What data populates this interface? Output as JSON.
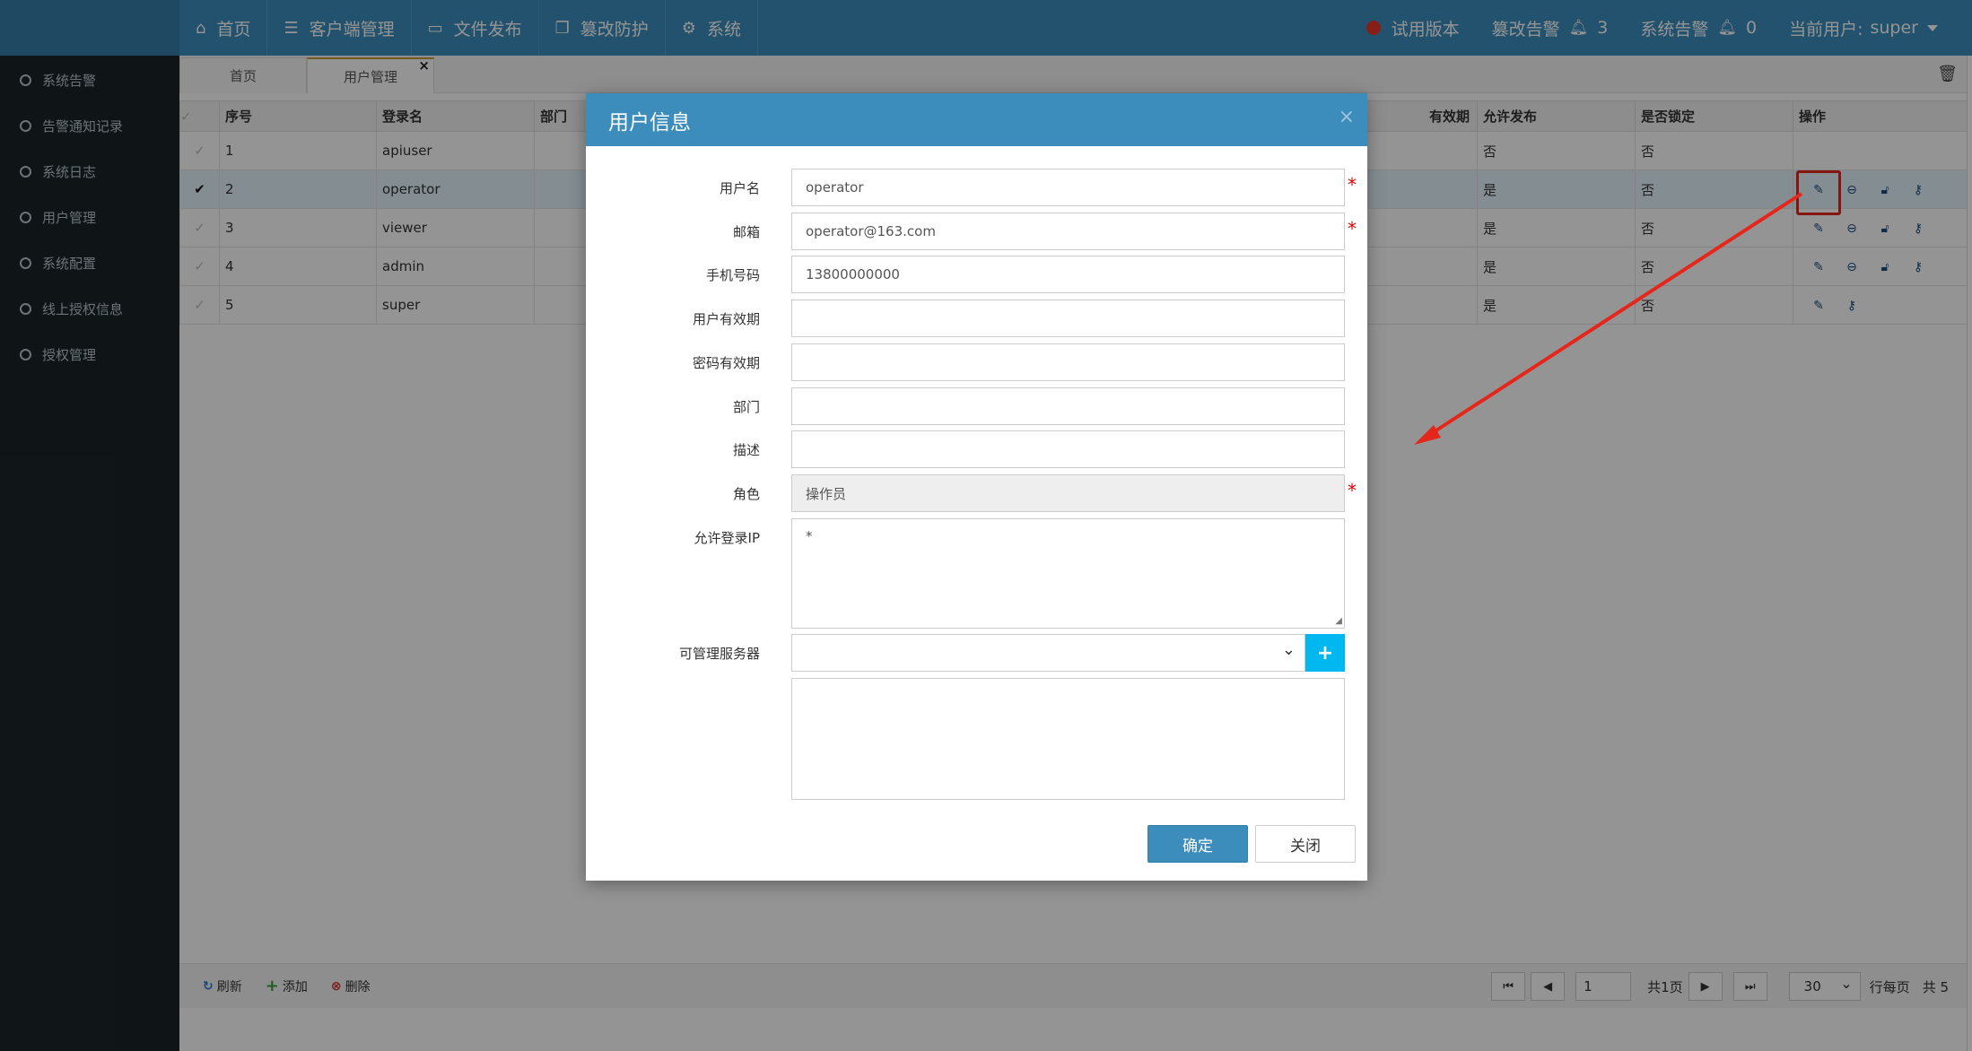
{
  "topnav": {
    "items": [
      {
        "icon": "home-icon",
        "glyph": "⌂",
        "label": "首页"
      },
      {
        "icon": "server-icon",
        "glyph": "☰",
        "label": "客户端管理"
      },
      {
        "icon": "laptop-icon",
        "glyph": "▭",
        "label": "文件发布"
      },
      {
        "icon": "copy-icon",
        "glyph": "❐",
        "label": "篡改防护"
      },
      {
        "icon": "cogs-icon",
        "glyph": "⚙",
        "label": "系统"
      }
    ],
    "trial_label": "试用版本",
    "tamper_alert_label": "篡改告警",
    "tamper_alert_count": "3",
    "system_alert_label": "系统告警",
    "system_alert_count": "0",
    "current_user_label": "当前用户:",
    "current_user": "super"
  },
  "sidebar": {
    "items": [
      {
        "label": "系统告警"
      },
      {
        "label": "告警通知记录"
      },
      {
        "label": "系统日志"
      },
      {
        "label": "用户管理"
      },
      {
        "label": "系统配置"
      },
      {
        "label": "线上授权信息"
      },
      {
        "label": "授权管理"
      }
    ]
  },
  "tabs": {
    "home": "首页",
    "user_mgmt": "用户管理",
    "close_glyph": "×"
  },
  "grid": {
    "headers": {
      "index": "序号",
      "login": "登录名",
      "dept": "部门",
      "expire": "有效期",
      "allow_publish": "允许发布",
      "locked": "是否锁定",
      "ops": "操作"
    },
    "rows": [
      {
        "index": "1",
        "login": "apiuser",
        "allow_publish": "否",
        "locked": "否"
      },
      {
        "index": "2",
        "login": "operator",
        "allow_publish": "是",
        "locked": "否"
      },
      {
        "index": "3",
        "login": "viewer",
        "allow_publish": "是",
        "locked": "否"
      },
      {
        "index": "4",
        "login": "admin",
        "allow_publish": "是",
        "locked": "否"
      },
      {
        "index": "5",
        "login": "super",
        "allow_publish": "是",
        "locked": "否"
      }
    ]
  },
  "footer": {
    "refresh": "刷新",
    "add": "添加",
    "delete": "删除",
    "page_value": "1",
    "total_pages": "共1页",
    "page_size": "30",
    "rows_per_page": "行每页",
    "total": "共 5"
  },
  "modal": {
    "title": "用户信息",
    "fields": {
      "username_label": "用户名",
      "username_value": "operator",
      "email_label": "邮箱",
      "email_value": "operator@163.com",
      "phone_label": "手机号码",
      "phone_value": "13800000000",
      "user_expire_label": "用户有效期",
      "user_expire_value": "",
      "pwd_expire_label": "密码有效期",
      "pwd_expire_value": "",
      "dept_label": "部门",
      "dept_value": "",
      "desc_label": "描述",
      "desc_value": "",
      "role_label": "角色",
      "role_value": "操作员",
      "allow_ip_label": "允许登录IP",
      "allow_ip_value": "*",
      "servers_label": "可管理服务器"
    },
    "required_mark": "*",
    "ok": "确定",
    "close": "关闭"
  },
  "colors": {
    "header": "#3c8dbc",
    "sidebar": "#1b2429",
    "highlight_box": "#e5261b",
    "plus_button": "#00b7f0"
  }
}
